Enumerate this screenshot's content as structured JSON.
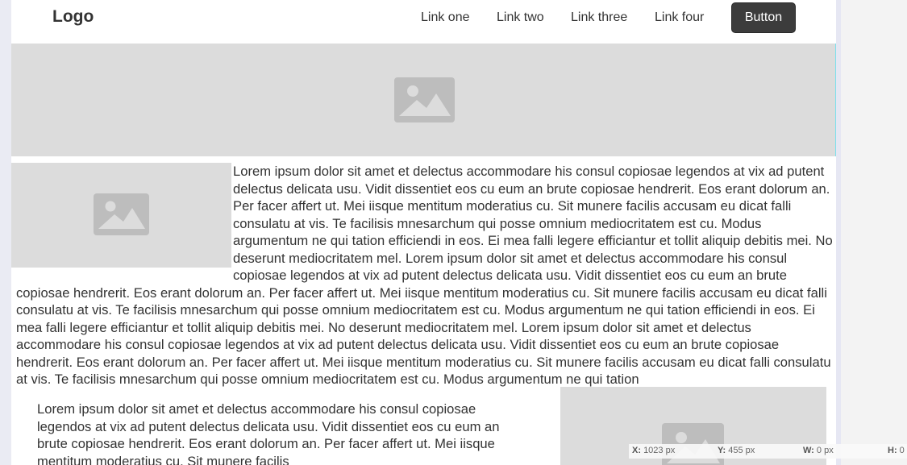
{
  "nav": {
    "logo": "Logo",
    "links": [
      "Link one",
      "Link two",
      "Link three",
      "Link four"
    ],
    "button_label": "Button"
  },
  "content": {
    "paragraph1": "Lorem ipsum dolor sit amet et delectus accommodare his consul copiosae legendos at vix ad putent delectus delicata usu. Vidit dissentiet eos cu eum an brute copiosae hendrerit. Eos erant dolorum an. Per facer affert ut. Mei iisque mentitum moderatius cu. Sit munere facilis accusam eu dicat falli consulatu at vis. Te facilisis mnesarchum qui posse omnium mediocritatem est cu. Modus argumentum ne qui tation efficiendi in eos. Ei mea falli legere efficiantur et tollit aliquip debitis mei. No deserunt mediocritatem mel. Lorem ipsum dolor sit amet et delectus accommodare his consul copiosae legendos at vix ad putent delectus delicata usu. Vidit dissentiet eos cu eum an brute copiosae hendrerit. Eos erant dolorum an. Per facer affert ut. Mei iisque mentitum moderatius cu. Sit munere facilis accusam eu dicat falli consulatu at vis. Te facilisis mnesarchum qui posse omnium mediocritatem est cu. Modus argumentum ne qui tation efficiendi in eos. Ei mea falli legere efficiantur et tollit aliquip debitis mei. No deserunt mediocritatem mel. Lorem ipsum dolor sit amet et delectus accommodare his consul copiosae legendos at vix ad putent delectus delicata usu. Vidit dissentiet eos cu eum an brute copiosae hendrerit. Eos erant dolorum an. Per facer affert ut. Mei iisque mentitum moderatius cu. Sit munere facilis accusam eu dicat falli consulatu at vis. Te facilisis mnesarchum qui posse omnium mediocritatem est cu. Modus argumentum ne qui tation",
    "paragraph2": "Lorem ipsum dolor sit amet et delectus accommodare his consul copiosae legendos at vix ad putent delectus delicata usu. Vidit dissentiet eos cu eum an brute copiosae hendrerit. Eos erant dolorum an. Per facer affert ut. Mei iisque mentitum moderatius cu. Sit munere facilis"
  },
  "status": {
    "x": "1023 px",
    "y": "455 px",
    "w": "0 px",
    "h": "0"
  }
}
